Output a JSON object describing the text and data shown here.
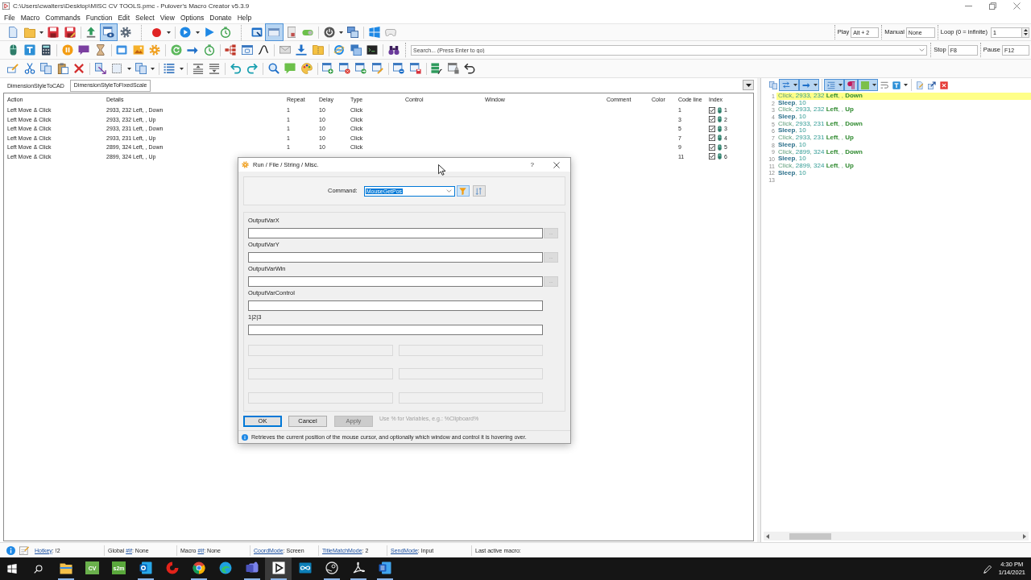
{
  "window": {
    "title": "C:\\Users\\cwalters\\Desktop\\MISC CV TOOLS.pmc - Pulover's Macro Creator v5.3.9"
  },
  "menu": [
    "File",
    "Macro",
    "Commands",
    "Function",
    "Edit",
    "Select",
    "View",
    "Options",
    "Donate",
    "Help"
  ],
  "toolbars": {
    "main": [
      {
        "pressed": true
      },
      {
        "pressed": true
      }
    ],
    "editor": [
      {
        "pressed": true
      },
      {
        "pressed": true
      },
      {
        "pressed": true
      },
      {
        "pressed": true
      },
      {
        "pressed": true
      }
    ]
  },
  "playback": {
    "play": {
      "label": "Play",
      "value": "Alt + 2"
    },
    "manual": {
      "label": "Manual",
      "value": "None"
    },
    "loop": {
      "label": "Loop (0 = infinite)",
      "value": "1"
    },
    "stop": {
      "label": "Stop",
      "value": "F8"
    },
    "pause": {
      "label": "Pause",
      "value": "F12"
    }
  },
  "search": {
    "placeholder": "Search... (Press Enter to go)"
  },
  "macro_tabs": [
    {
      "label": "DimensionStyleToCAD",
      "selected": false
    },
    {
      "label": "DimensionStyleToFixedScale",
      "selected": true
    }
  ],
  "table": {
    "columns": [
      "Action",
      "Details",
      "Repeat",
      "Delay",
      "Type",
      "Control",
      "Window",
      "Comment",
      "Color",
      "Code line",
      "Index"
    ],
    "rows": [
      {
        "action": "Left Move & Click",
        "details": "2933, 232 Left, , Down",
        "repeat": "1",
        "delay": "10",
        "type": "Click",
        "code_line": "1",
        "checked": true,
        "index": "1"
      },
      {
        "action": "Left Move & Click",
        "details": "2933, 232 Left, , Up",
        "repeat": "1",
        "delay": "10",
        "type": "Click",
        "code_line": "3",
        "checked": true,
        "index": "2"
      },
      {
        "action": "Left Move & Click",
        "details": "2933, 231 Left, , Down",
        "repeat": "1",
        "delay": "10",
        "type": "Click",
        "code_line": "5",
        "checked": true,
        "index": "3"
      },
      {
        "action": "Left Move & Click",
        "details": "2933, 231 Left, , Up",
        "repeat": "1",
        "delay": "10",
        "type": "Click",
        "code_line": "7",
        "checked": true,
        "index": "4"
      },
      {
        "action": "Left Move & Click",
        "details": "2899, 324 Left, , Down",
        "repeat": "1",
        "delay": "10",
        "type": "Click",
        "code_line": "9",
        "checked": true,
        "index": "5"
      },
      {
        "action": "Left Move & Click",
        "details": "2899, 324 Left, , Up",
        "code_line": "11",
        "checked": true,
        "index": "6"
      }
    ]
  },
  "code": {
    "lines": [
      {
        "number": "1",
        "highlighted": true,
        "tokens": [
          {
            "text": "Click",
            "kind": "command"
          },
          {
            "text": ", ",
            "kind": "plain"
          },
          {
            "text": "2933",
            "kind": "number"
          },
          {
            "text": ", ",
            "kind": "plain"
          },
          {
            "text": "232",
            "kind": "number"
          },
          {
            "text": " Left",
            "kind": "keyword"
          },
          {
            "text": ", , ",
            "kind": "plain"
          },
          {
            "text": "Down",
            "kind": "keyword"
          }
        ]
      },
      {
        "number": "2",
        "highlighted": false,
        "tokens": [
          {
            "text": "Sleep",
            "kind": "flow"
          },
          {
            "text": ", ",
            "kind": "plain"
          },
          {
            "text": "10",
            "kind": "number"
          }
        ]
      },
      {
        "number": "3",
        "highlighted": false,
        "tokens": [
          {
            "text": "Click",
            "kind": "command"
          },
          {
            "text": ", ",
            "kind": "plain"
          },
          {
            "text": "2933",
            "kind": "number"
          },
          {
            "text": ", ",
            "kind": "plain"
          },
          {
            "text": "232",
            "kind": "number"
          },
          {
            "text": " Left",
            "kind": "keyword"
          },
          {
            "text": ", , ",
            "kind": "plain"
          },
          {
            "text": "Up",
            "kind": "keyword"
          }
        ]
      },
      {
        "number": "4",
        "highlighted": false,
        "tokens": [
          {
            "text": "Sleep",
            "kind": "flow"
          },
          {
            "text": ", ",
            "kind": "plain"
          },
          {
            "text": "10",
            "kind": "number"
          }
        ]
      },
      {
        "number": "5",
        "highlighted": false,
        "tokens": [
          {
            "text": "Click",
            "kind": "command"
          },
          {
            "text": ", ",
            "kind": "plain"
          },
          {
            "text": "2933",
            "kind": "number"
          },
          {
            "text": ", ",
            "kind": "plain"
          },
          {
            "text": "231",
            "kind": "number"
          },
          {
            "text": " Left",
            "kind": "keyword"
          },
          {
            "text": ", , ",
            "kind": "plain"
          },
          {
            "text": "Down",
            "kind": "keyword"
          }
        ]
      },
      {
        "number": "6",
        "highlighted": false,
        "tokens": [
          {
            "text": "Sleep",
            "kind": "flow"
          },
          {
            "text": ", ",
            "kind": "plain"
          },
          {
            "text": "10",
            "kind": "number"
          }
        ]
      },
      {
        "number": "7",
        "highlighted": false,
        "tokens": [
          {
            "text": "Click",
            "kind": "command"
          },
          {
            "text": ", ",
            "kind": "plain"
          },
          {
            "text": "2933",
            "kind": "number"
          },
          {
            "text": ", ",
            "kind": "plain"
          },
          {
            "text": "231",
            "kind": "number"
          },
          {
            "text": " Left",
            "kind": "keyword"
          },
          {
            "text": ", , ",
            "kind": "plain"
          },
          {
            "text": "Up",
            "kind": "keyword"
          }
        ]
      },
      {
        "number": "8",
        "highlighted": false,
        "tokens": [
          {
            "text": "Sleep",
            "kind": "flow"
          },
          {
            "text": ", ",
            "kind": "plain"
          },
          {
            "text": "10",
            "kind": "number"
          }
        ]
      },
      {
        "number": "9",
        "highlighted": false,
        "tokens": [
          {
            "text": "Click",
            "kind": "command"
          },
          {
            "text": ", ",
            "kind": "plain"
          },
          {
            "text": "2899",
            "kind": "number"
          },
          {
            "text": ", ",
            "kind": "plain"
          },
          {
            "text": "324",
            "kind": "number"
          },
          {
            "text": " Left",
            "kind": "keyword"
          },
          {
            "text": ", , ",
            "kind": "plain"
          },
          {
            "text": "Down",
            "kind": "keyword"
          }
        ]
      },
      {
        "number": "10",
        "highlighted": false,
        "tokens": [
          {
            "text": "Sleep",
            "kind": "flow"
          },
          {
            "text": ", ",
            "kind": "plain"
          },
          {
            "text": "10",
            "kind": "number"
          }
        ]
      },
      {
        "number": "11",
        "highlighted": false,
        "tokens": [
          {
            "text": "Click",
            "kind": "command"
          },
          {
            "text": ", ",
            "kind": "plain"
          },
          {
            "text": "2899",
            "kind": "number"
          },
          {
            "text": ", ",
            "kind": "plain"
          },
          {
            "text": "324",
            "kind": "number"
          },
          {
            "text": " Left",
            "kind": "keyword"
          },
          {
            "text": ", , ",
            "kind": "plain"
          },
          {
            "text": "Up",
            "kind": "keyword"
          }
        ]
      },
      {
        "number": "12",
        "highlighted": false,
        "tokens": [
          {
            "text": "Sleep",
            "kind": "flow"
          },
          {
            "text": ", ",
            "kind": "plain"
          },
          {
            "text": "10",
            "kind": "number"
          }
        ]
      },
      {
        "number": "13",
        "highlighted": false
      }
    ]
  },
  "dialog": {
    "title": "Run / File / String / Misc.",
    "help": "?",
    "command": {
      "label": "Command:",
      "value": "MouseGetPos",
      "highlighted": true,
      "filter_on": true
    },
    "fields": [
      {
        "label": "OutputVarX",
        "browse": "..."
      },
      {
        "label": "OutputVarY",
        "browse": "..."
      },
      {
        "label": "OutputVarWin",
        "browse": "..."
      },
      {
        "label": "OutputVarControl"
      },
      {
        "label": "1|2|3"
      }
    ],
    "extra_fields": [
      {
        "disabled": true
      },
      {
        "disabled": true
      },
      {
        "disabled": true
      },
      {
        "disabled": true
      },
      {
        "disabled": true
      },
      {
        "disabled": true
      }
    ],
    "buttons": [
      {
        "label": "OK",
        "default": true,
        "disabled": false
      },
      {
        "label": "Cancel",
        "default": false,
        "disabled": false
      },
      {
        "label": "Apply",
        "default": false,
        "disabled": true
      }
    ],
    "hint": "Use % for Variables, e.g.: %Clipboard%",
    "description": "Retrieves the current position of the mouse cursor, and optionally which window and control it is hovering over."
  },
  "status_bar": {
    "items": [
      {
        "parts": [
          {
            "text": "Hotkey",
            "link": true
          },
          {
            "text": ": !2",
            "link": false
          }
        ]
      },
      {
        "parts": [
          {
            "text": "Global ",
            "link": false
          },
          {
            "text": "#If",
            "link": true
          },
          {
            "text": ": None",
            "link": false
          }
        ]
      },
      {
        "parts": [
          {
            "text": "Macro ",
            "link": false
          },
          {
            "text": "#If",
            "link": true
          },
          {
            "text": ": None",
            "link": false
          }
        ]
      },
      {
        "parts": [
          {
            "text": "CoordMode",
            "link": true
          },
          {
            "text": ": Screen",
            "link": false
          }
        ]
      },
      {
        "parts": [
          {
            "text": "TitleMatchMode",
            "link": true
          },
          {
            "text": ": 2",
            "link": false
          }
        ]
      },
      {
        "parts": [
          {
            "text": "SendMode",
            "link": true
          },
          {
            "text": ": Input",
            "link": false
          }
        ]
      },
      {
        "parts": [
          {
            "text": "Last active macro:",
            "link": false
          }
        ]
      }
    ]
  },
  "taskbar": {
    "apps": [
      {
        "running": true,
        "selected": false
      },
      {
        "label": "CV",
        "running": false,
        "selected": false
      },
      {
        "label": "s2m",
        "running": false,
        "selected": false
      },
      {
        "running": true,
        "selected": false
      },
      {
        "running": false,
        "selected": false
      },
      {
        "running": true,
        "selected": false
      },
      {
        "running": false,
        "selected": false
      },
      {
        "running": true,
        "selected": false
      },
      {
        "running": true,
        "selected": true
      },
      {
        "running": false,
        "selected": false
      },
      {
        "running": true,
        "selected": false
      },
      {
        "running": true,
        "selected": false
      },
      {
        "running": true,
        "selected": false
      }
    ],
    "clock": {
      "time": "4:30 PM",
      "date": "1/14/2021"
    }
  }
}
